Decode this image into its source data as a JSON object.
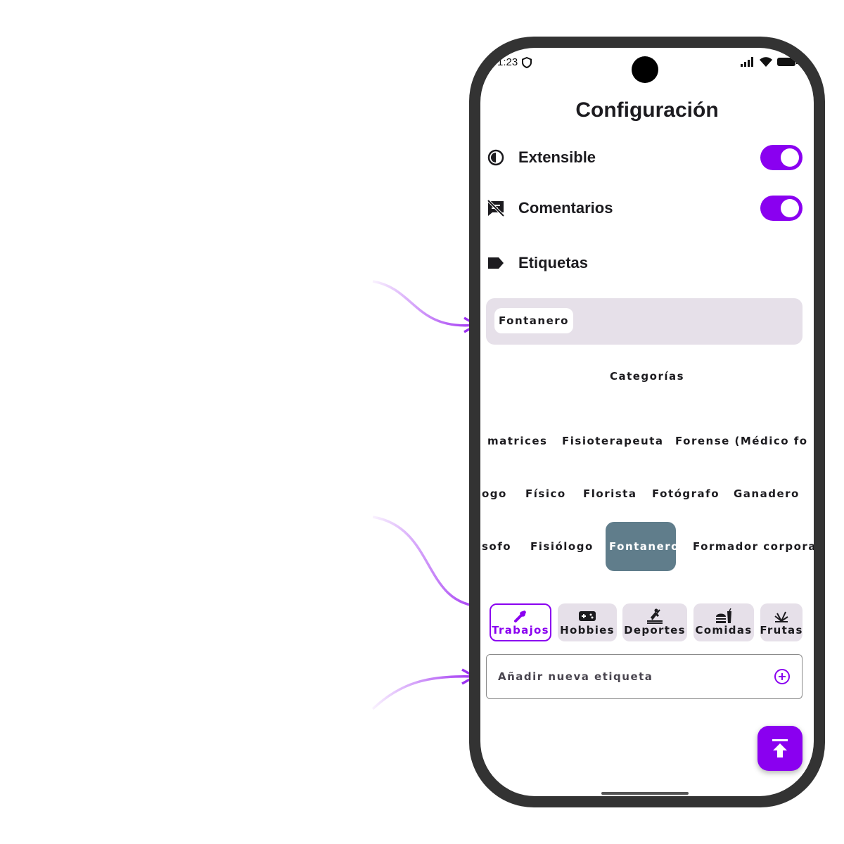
{
  "status_bar": {
    "time": "1:23"
  },
  "header": {
    "title": "Configuración"
  },
  "settings": {
    "extensible": {
      "label": "Extensible",
      "enabled": true
    },
    "comentarios": {
      "label": "Comentarios",
      "enabled": true
    },
    "etiquetas": {
      "label": "Etiquetas"
    }
  },
  "selected_tags": [
    "Fontanero"
  ],
  "categories_title": "Categorías",
  "category_items": {
    "row1": [
      "matrices",
      "Fisioterapeuta",
      "Forense (Médico fo"
    ],
    "row2": [
      "ogo",
      "Físico",
      "Florista",
      "Fotógrafo",
      "Ganadero"
    ],
    "row3": [
      "sofo",
      "Fisiólogo",
      "Fontanero",
      "Formador corpora"
    ]
  },
  "selected_item": "Fontanero",
  "category_tabs": [
    {
      "label": "Trabajos",
      "icon": "wrench-icon",
      "active": true
    },
    {
      "label": "Hobbies",
      "icon": "gamepad-icon",
      "active": false
    },
    {
      "label": "Deportes",
      "icon": "rowing-icon",
      "active": false
    },
    {
      "label": "Comidas",
      "icon": "food-icon",
      "active": false
    },
    {
      "label": "Frutas",
      "icon": "fruit-icon",
      "active": false
    }
  ],
  "new_tag_input": {
    "placeholder": "Añadir nueva etiqueta"
  },
  "colors": {
    "accent": "#8a00f0",
    "chip_selected": "#607d8b",
    "surface": "#e6e0e9",
    "phone_frame": "#333333"
  }
}
